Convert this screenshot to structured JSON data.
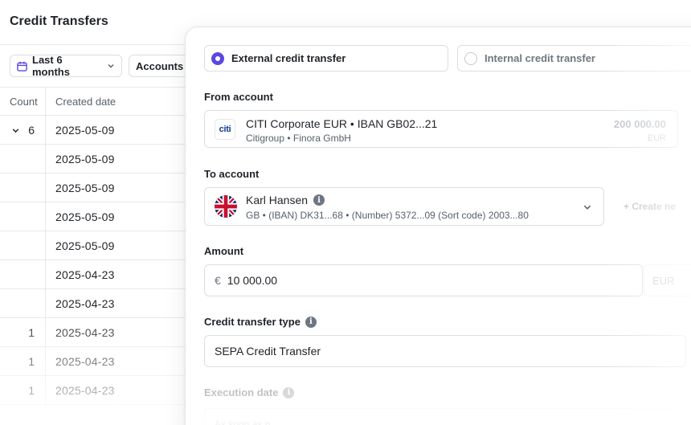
{
  "background": {
    "title": "Credit Transfers",
    "filters": {
      "date_range_label": "Last 6 months",
      "accounts_label": "Accounts"
    },
    "table": {
      "headers": {
        "count": "Count",
        "created_date": "Created date"
      },
      "rows": [
        {
          "count": "6",
          "date": "2025-05-09",
          "expanded": true
        },
        {
          "count": "",
          "date": "2025-05-09"
        },
        {
          "count": "",
          "date": "2025-05-09"
        },
        {
          "count": "",
          "date": "2025-05-09"
        },
        {
          "count": "",
          "date": "2025-05-09"
        },
        {
          "count": "",
          "date": "2025-04-23"
        },
        {
          "count": "",
          "date": "2025-04-23"
        },
        {
          "count": "1",
          "date": "2025-04-23"
        },
        {
          "count": "1",
          "date": "2025-04-23"
        },
        {
          "count": "1",
          "date": "2025-04-23"
        }
      ]
    }
  },
  "form": {
    "transfer_kind": {
      "external_label": "External credit transfer",
      "internal_label": "Internal credit transfer",
      "selected": "external"
    },
    "from_account": {
      "label": "From account",
      "logo_text": "citi",
      "name": "CITI Corporate EUR • IBAN GB02...21",
      "sub": "Citigroup • Finora GmbH",
      "balance": "200 000.00",
      "currency": "EUR"
    },
    "to_account": {
      "label": "To account",
      "name": "Karl Hansen",
      "details": "GB •  (IBAN) DK31...68 • (Number) 5372...09 (Sort code) 2003...80",
      "create_label": "+ Create ne"
    },
    "amount": {
      "label": "Amount",
      "currency_symbol": "€",
      "value": "10 000.00",
      "currency": "EUR"
    },
    "credit_transfer_type": {
      "label": "Credit transfer type",
      "value": "SEPA Credit Transfer"
    },
    "execution_date": {
      "label": "Execution date",
      "placeholder": "As soon as p"
    }
  },
  "colors": {
    "accent": "#5b47e0",
    "border": "#dcdee1",
    "muted_text": "#57606a"
  }
}
